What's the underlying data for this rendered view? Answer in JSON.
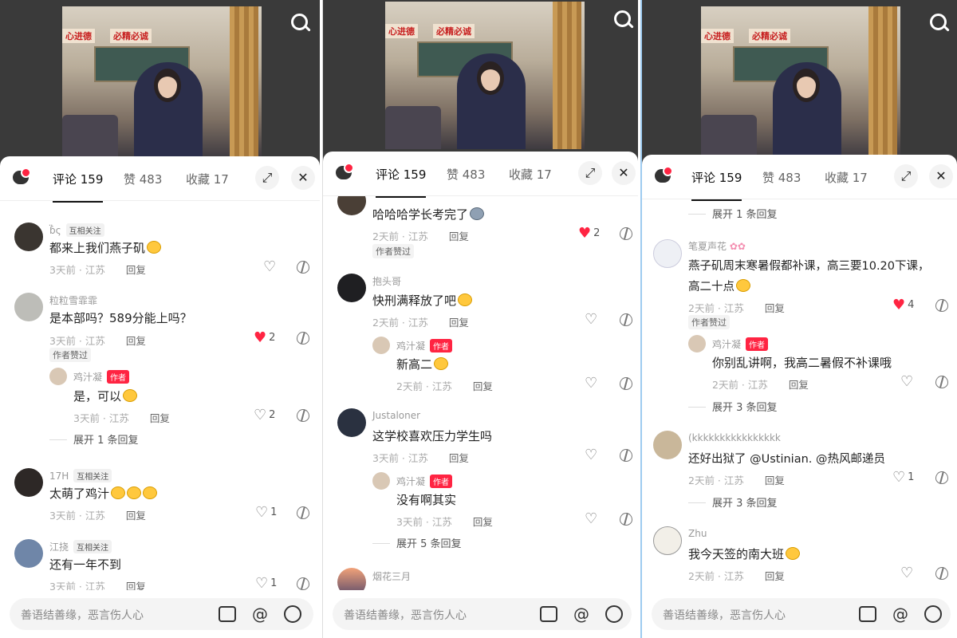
{
  "header": {
    "comments_tab": "评论 159",
    "likes_tab": "赞 483",
    "favorites_tab": "收藏 17"
  },
  "input_placeholder": "善语结善缘，恶言伤人心",
  "photo_banners": [
    "心进德",
    "必精必诚"
  ],
  "panel1": {
    "c1": {
      "user": "",
      "tag": "互相关注",
      "text": "都来上我们燕子矶",
      "meta": "3天前 · 江苏",
      "reply": "回复"
    },
    "c2": {
      "user": "粒粒雪霏霏",
      "text": "是本部吗？589分能上吗？",
      "meta": "3天前 · 江苏",
      "reply": "回复",
      "likes": "2",
      "liked_label": "作者赞过"
    },
    "c2r": {
      "user": "鸡汁凝",
      "tag": "作者",
      "text": "是，可以",
      "meta": "3天前 · 江苏",
      "reply": "回复",
      "likes": "2"
    },
    "c2x": "展开 1 条回复",
    "c3": {
      "user": "17H",
      "tag": "互相关注",
      "text": "太萌了鸡汁",
      "meta": "3天前 · 江苏",
      "reply": "回复",
      "likes": "1"
    },
    "c4": {
      "user": "江挠",
      "tag": "互相关注",
      "text": "还有一年不到",
      "meta": "3天前 · 江苏",
      "reply": "回复",
      "likes": "1"
    }
  },
  "panel2": {
    "c1": {
      "text": "哈哈哈学长考完了",
      "meta": "2天前 · 江苏",
      "reply": "回复",
      "likes": "2",
      "liked_label": "作者赞过"
    },
    "c2": {
      "user": "抱头哥",
      "text": "快刑满释放了吧",
      "meta": "2天前 · 江苏",
      "reply": "回复"
    },
    "c2r": {
      "user": "鸡汁凝",
      "tag": "作者",
      "text": "新高二",
      "meta": "2天前 · 江苏",
      "reply": "回复"
    },
    "c3": {
      "user": "Justaloner",
      "text": "这学校喜欢压力学生吗",
      "meta": "3天前 · 江苏",
      "reply": "回复"
    },
    "c3r": {
      "user": "鸡汁凝",
      "tag": "作者",
      "text": "没有啊其实",
      "meta": "3天前 · 江苏",
      "reply": "回复"
    },
    "c3x": "展开 5 条回复",
    "c4": {
      "user": "烟花三月"
    }
  },
  "panel3": {
    "x0": "展开 1 条回复",
    "c1": {
      "user": "笔夏声花",
      "text1": "燕子矶周末寒暑假都补课，高三要10.20下课，",
      "text2": "高二十点",
      "meta": "2天前 · 江苏",
      "reply": "回复",
      "likes": "4",
      "liked_label": "作者赞过"
    },
    "c1r": {
      "user": "鸡汁凝",
      "tag": "作者",
      "text": "你别乱讲啊，我高二暑假不补课哦",
      "meta": "2天前 · 江苏",
      "reply": "回复"
    },
    "c1x": "展开 3 条回复",
    "c2": {
      "user": "(kkkkkkkkkkkkkkkk",
      "text": "还好出狱了 @Ustinian. @热风邮递员",
      "meta": "2天前 · 江苏",
      "reply": "回复",
      "likes": "1"
    },
    "c2x": "展开 3 条回复",
    "c3": {
      "user": "Zhu",
      "text": "我今天签的南大班",
      "meta": "2天前 · 江苏",
      "reply": "回复"
    }
  }
}
